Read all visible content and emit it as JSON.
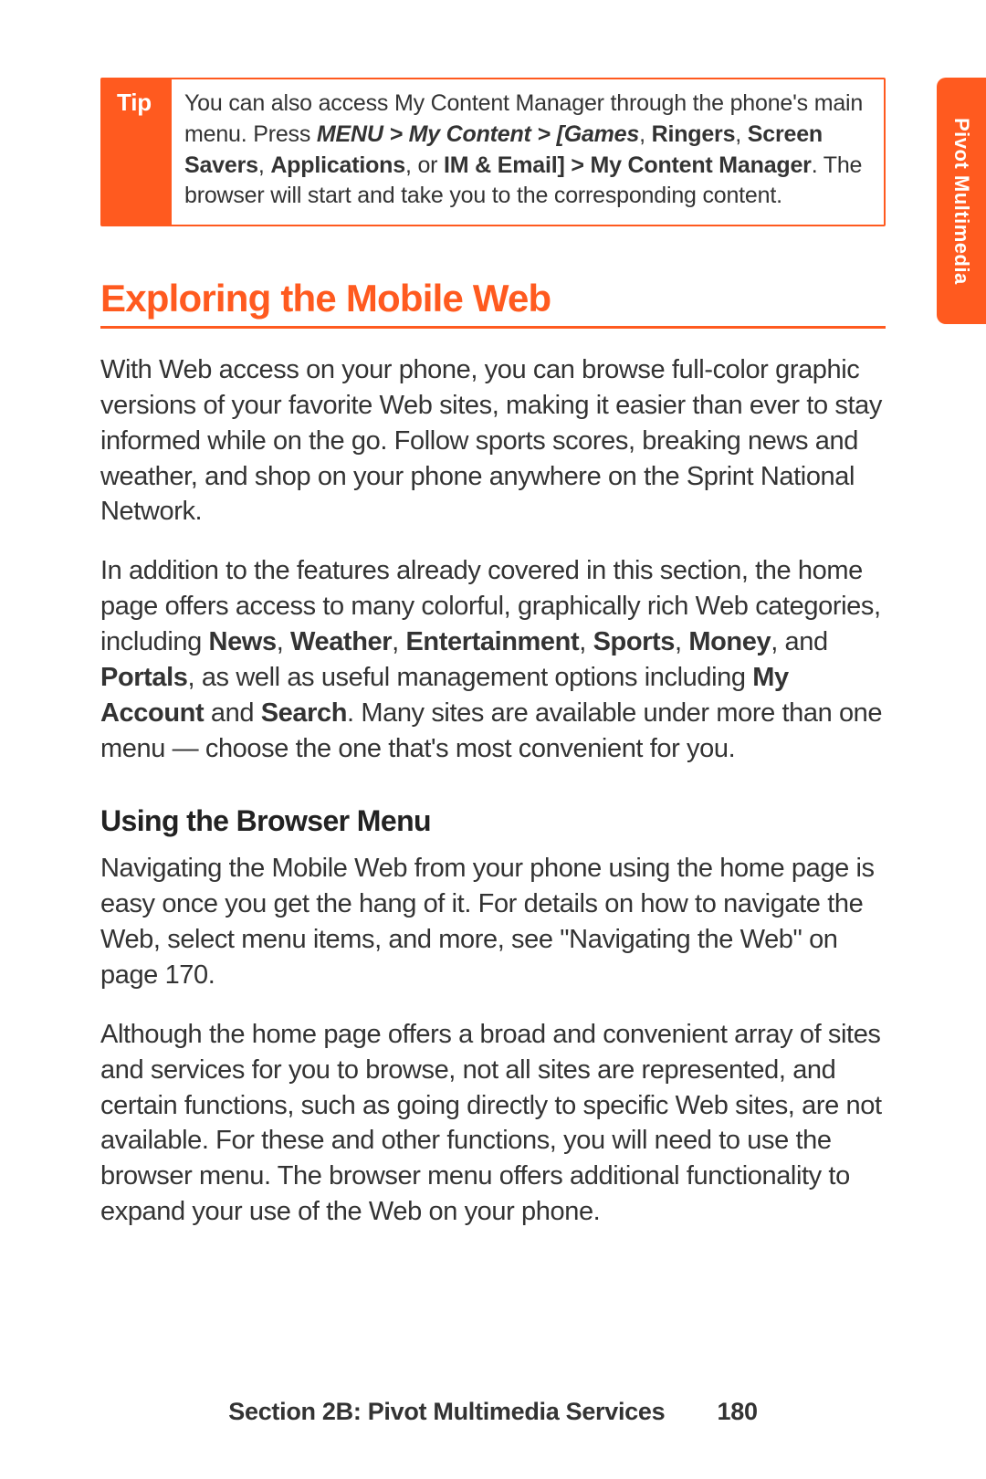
{
  "side_tab": {
    "label": "Pivot Multimedia"
  },
  "tip": {
    "label": "Tip",
    "text_plain": "You can also access My Content Manager through the phone's main menu. Press ",
    "menu_path_1": "MENU > My Content > [Games",
    "sep1": ", ",
    "bold2": "Ringers",
    "sep2": ", ",
    "bold3": "Screen Savers",
    "sep3": ", ",
    "bold4": "Applications",
    "sep4": ", or ",
    "bold5": "IM & Email] > My Content Manager",
    "tail": ". The browser will start and take you to the corresponding content."
  },
  "heading": "Exploring the Mobile Web",
  "para1": "With Web access on your phone, you can browse full-color graphic versions of your favorite Web sites, making it easier than ever to stay informed while on the go. Follow sports scores, breaking news and weather, and shop on your phone anywhere on the Sprint National Network.",
  "para2": {
    "pre": "In addition to the features already covered in this section, the home page offers access to many colorful, graphically rich Web categories, including ",
    "b1": "News",
    "s1": ", ",
    "b2": "Weather",
    "s2": ", ",
    "b3": "Entertainment",
    "s3": ", ",
    "b4": "Sports",
    "s4": ", ",
    "b5": "Money",
    "s5": ", and ",
    "b6": "Portals",
    "s6": ", as well as useful management options including ",
    "b7": "My Account",
    "s7": " and ",
    "b8": "Search",
    "tail": ". Many sites are available under more than one menu — choose the one that's most convenient for you."
  },
  "subheading": "Using the Browser Menu",
  "para3": "Navigating the Mobile Web from your phone using the home page is easy once you get the hang of it. For details on how to navigate the Web, select menu items, and more, see \"Navigating the Web\" on page 170.",
  "para4": "Although the home page offers a broad and convenient array of sites and services for you to browse, not all sites are represented, and certain functions, such as going directly to specific Web sites, are not available. For these and other functions, you will need to use the browser menu. The browser menu offers additional functionality to expand your use of the Web on your phone.",
  "footer": {
    "section": "Section 2B: Pivot Multimedia Services",
    "page": "180"
  }
}
